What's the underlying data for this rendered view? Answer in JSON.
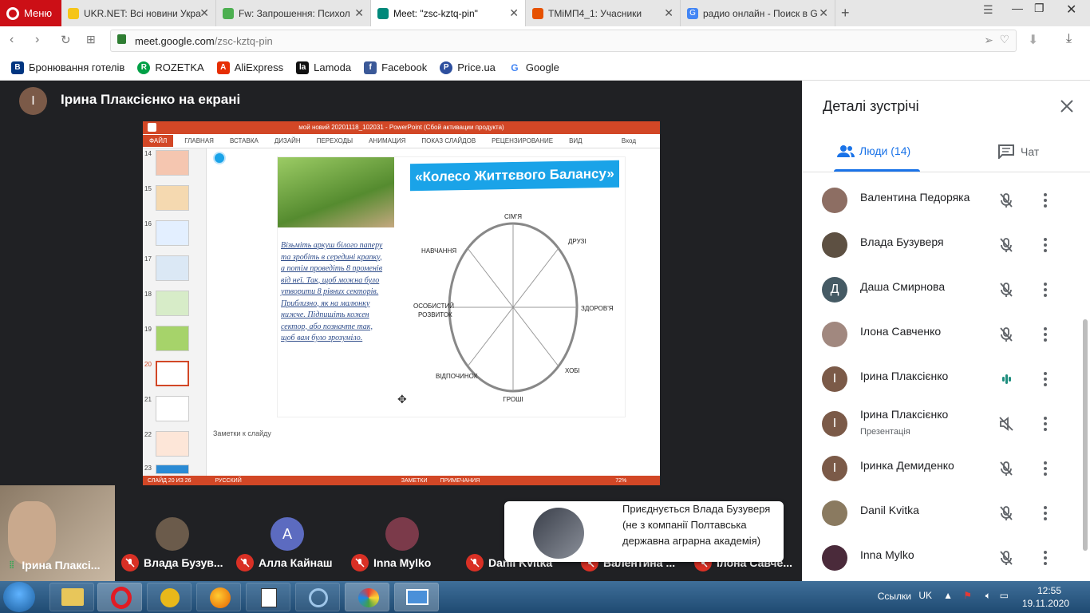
{
  "browser": {
    "menu_label": "Меню",
    "tabs": [
      {
        "title": "UKR.NET: Всі новини Укра",
        "color": "#f5c518"
      },
      {
        "title": "Fw: Запрошення: Психол",
        "color": "#4caf50"
      },
      {
        "title": "Meet: \"zsc-kztq-pin\"",
        "color": "#00897b"
      },
      {
        "title": "ТМіМП4_1: Учасники",
        "color": "#e65100"
      },
      {
        "title": "радио онлайн - Поиск в G",
        "color": "#4285f4"
      }
    ],
    "url_host": "meet.google.com",
    "url_path": "/zsc-kztq-pin",
    "bookmarks": [
      {
        "label": "Бронювання готелів",
        "color": "#003580",
        "glyph": "B"
      },
      {
        "label": "ROZETKA",
        "color": "#00a046",
        "glyph": "R"
      },
      {
        "label": "AliExpress",
        "color": "#e62e04",
        "glyph": "A"
      },
      {
        "label": "Lamoda",
        "color": "#111111",
        "glyph": "la"
      },
      {
        "label": "Facebook",
        "color": "#3b5998",
        "glyph": "f"
      },
      {
        "label": "Price.ua",
        "color": "#2d4f9e",
        "glyph": "P"
      },
      {
        "label": "Google",
        "color": "#ffffff",
        "glyph": "G"
      }
    ]
  },
  "meet": {
    "presenter_initial": "І",
    "presenter_label": "Ірина Плаксієнко на екрані",
    "ppt": {
      "title": "мой новий 20201118_102031 - PowerPoint (Сбой активации продукта)",
      "ribbon": [
        "ФАЙЛ",
        "ГЛАВНАЯ",
        "ВСТАВКА",
        "ДИЗАЙН",
        "ПЕРЕХОДЫ",
        "АНИМАЦИЯ",
        "ПОКАЗ СЛАЙДОВ",
        "РЕЦЕНЗИРОВАНИЕ",
        "ВИД"
      ],
      "signin": "Вход",
      "thumb_numbers": [
        "14",
        "15",
        "16",
        "17",
        "18",
        "19",
        "20",
        "21",
        "22",
        "23"
      ],
      "slide_title": "«Колесо Життєвого Балансу»",
      "slide_text": "Візьміть аркуш білого паперу та зробіть в середині крапку, а потім проведіть 8 променів від неї. Так, щоб можна було утворити 8 рівних секторів. Приблизно, як на малюнку нижче. Підпишіть кожен сектор, або позначте так, щоб вам було зрозуміло.",
      "wheel_labels": {
        "top": "СІМ'Я",
        "top_right": "ДРУЗІ",
        "right": "ЗДОРОВ'Я",
        "bottom_right": "ХОБІ",
        "bottom": "ГРОШІ",
        "bottom_left": "ВІДПОЧИНОК",
        "left_1": "ОСОБИСТИЙ",
        "left_2": "РОЗВИТОК",
        "top_left": "НАВЧАННЯ"
      },
      "notes_placeholder": "Заметки к слайду",
      "status_slide": "СЛАЙД 20 ИЗ 26",
      "status_lang": "РУССКИЙ",
      "status_notes": "ЗАМЕТКИ",
      "status_comments": "ПРИМЕЧАНИЯ",
      "zoom": "72%"
    },
    "tiles": [
      {
        "name": "Ірина Плаксі...",
        "self": true
      },
      {
        "name": "Влада Бузув...",
        "initial": "",
        "color": "#6b5b4b"
      },
      {
        "name": "Алла Кайнаш",
        "initial": "A",
        "color": "#5c6bc0"
      },
      {
        "name": "Inna Mylko",
        "initial": "",
        "color": "#7b3a4a"
      },
      {
        "name": "Danil Kvitka",
        "initial": "",
        "color": "#555555"
      },
      {
        "name": "Валентина ...",
        "initial": "",
        "color": "#555555"
      },
      {
        "name": "Ілона Савче...",
        "initial": "",
        "color": "#555555"
      }
    ],
    "toast_message": "Приєднується Влада Бузуверя (не з компанії Полтавська державна аграрна академія)"
  },
  "details": {
    "title": "Деталі зустрічі",
    "people_tab": "Люди (14)",
    "chat_tab": "Чат",
    "people": [
      {
        "name": "Валентина Педоряка",
        "initial": "",
        "color": "#8d6e63",
        "mic": "muted"
      },
      {
        "name": "Влада Бузуверя",
        "initial": "",
        "color": "#5d5042",
        "mic": "muted"
      },
      {
        "name": "Даша Смирнова",
        "initial": "Д",
        "color": "#455a64",
        "mic": "muted"
      },
      {
        "name": "Ілона Савченко",
        "initial": "",
        "color": "#a1887f",
        "mic": "muted"
      },
      {
        "name": "Ірина Плаксієнко",
        "initial": "І",
        "color": "#7b5a48",
        "mic": "speaking"
      },
      {
        "name": "Ірина Плаксієнко",
        "sub": "Презентація",
        "initial": "І",
        "color": "#7b5a48",
        "mic": "audio-off"
      },
      {
        "name": "Іринка Демиденко",
        "initial": "І",
        "color": "#7b5a48",
        "mic": "muted"
      },
      {
        "name": "Danil Kvitka",
        "initial": "",
        "color": "#8a7a60",
        "mic": "muted"
      },
      {
        "name": "Inna Mylko",
        "initial": "",
        "color": "#4a2a3a",
        "mic": "muted"
      }
    ],
    "accent": "#1a73e8"
  },
  "taskbar": {
    "links_label": "Ссылки",
    "lang": "UK",
    "time": "12:55",
    "date": "19.11.2020"
  }
}
